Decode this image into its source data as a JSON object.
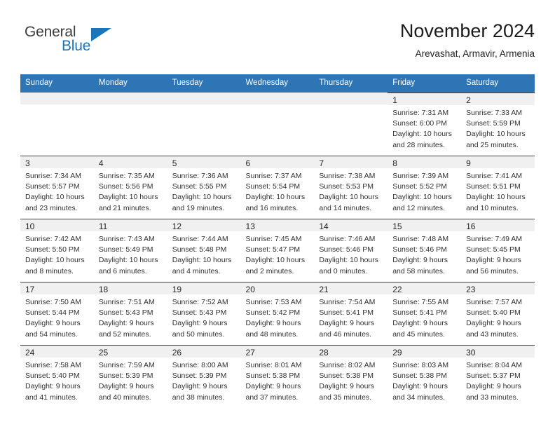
{
  "brand": {
    "name_part1": "General",
    "name_part2": "Blue",
    "triangle_color": "#1b75bb"
  },
  "header": {
    "title": "November 2024",
    "subtitle": "Arevashat, Armavir, Armenia",
    "header_bg_color": "#2e75b6",
    "daynum_bg_color": "#f0f0f0"
  },
  "weekday_headers": [
    "Sunday",
    "Monday",
    "Tuesday",
    "Wednesday",
    "Thursday",
    "Friday",
    "Saturday"
  ],
  "weeks": [
    [
      {
        "day": "",
        "sunrise": "",
        "sunset": "",
        "daylight1": "",
        "daylight2": ""
      },
      {
        "day": "",
        "sunrise": "",
        "sunset": "",
        "daylight1": "",
        "daylight2": ""
      },
      {
        "day": "",
        "sunrise": "",
        "sunset": "",
        "daylight1": "",
        "daylight2": ""
      },
      {
        "day": "",
        "sunrise": "",
        "sunset": "",
        "daylight1": "",
        "daylight2": ""
      },
      {
        "day": "",
        "sunrise": "",
        "sunset": "",
        "daylight1": "",
        "daylight2": ""
      },
      {
        "day": "1",
        "sunrise": "Sunrise: 7:31 AM",
        "sunset": "Sunset: 6:00 PM",
        "daylight1": "Daylight: 10 hours",
        "daylight2": "and 28 minutes."
      },
      {
        "day": "2",
        "sunrise": "Sunrise: 7:33 AM",
        "sunset": "Sunset: 5:59 PM",
        "daylight1": "Daylight: 10 hours",
        "daylight2": "and 25 minutes."
      }
    ],
    [
      {
        "day": "3",
        "sunrise": "Sunrise: 7:34 AM",
        "sunset": "Sunset: 5:57 PM",
        "daylight1": "Daylight: 10 hours",
        "daylight2": "and 23 minutes."
      },
      {
        "day": "4",
        "sunrise": "Sunrise: 7:35 AM",
        "sunset": "Sunset: 5:56 PM",
        "daylight1": "Daylight: 10 hours",
        "daylight2": "and 21 minutes."
      },
      {
        "day": "5",
        "sunrise": "Sunrise: 7:36 AM",
        "sunset": "Sunset: 5:55 PM",
        "daylight1": "Daylight: 10 hours",
        "daylight2": "and 19 minutes."
      },
      {
        "day": "6",
        "sunrise": "Sunrise: 7:37 AM",
        "sunset": "Sunset: 5:54 PM",
        "daylight1": "Daylight: 10 hours",
        "daylight2": "and 16 minutes."
      },
      {
        "day": "7",
        "sunrise": "Sunrise: 7:38 AM",
        "sunset": "Sunset: 5:53 PM",
        "daylight1": "Daylight: 10 hours",
        "daylight2": "and 14 minutes."
      },
      {
        "day": "8",
        "sunrise": "Sunrise: 7:39 AM",
        "sunset": "Sunset: 5:52 PM",
        "daylight1": "Daylight: 10 hours",
        "daylight2": "and 12 minutes."
      },
      {
        "day": "9",
        "sunrise": "Sunrise: 7:41 AM",
        "sunset": "Sunset: 5:51 PM",
        "daylight1": "Daylight: 10 hours",
        "daylight2": "and 10 minutes."
      }
    ],
    [
      {
        "day": "10",
        "sunrise": "Sunrise: 7:42 AM",
        "sunset": "Sunset: 5:50 PM",
        "daylight1": "Daylight: 10 hours",
        "daylight2": "and 8 minutes."
      },
      {
        "day": "11",
        "sunrise": "Sunrise: 7:43 AM",
        "sunset": "Sunset: 5:49 PM",
        "daylight1": "Daylight: 10 hours",
        "daylight2": "and 6 minutes."
      },
      {
        "day": "12",
        "sunrise": "Sunrise: 7:44 AM",
        "sunset": "Sunset: 5:48 PM",
        "daylight1": "Daylight: 10 hours",
        "daylight2": "and 4 minutes."
      },
      {
        "day": "13",
        "sunrise": "Sunrise: 7:45 AM",
        "sunset": "Sunset: 5:47 PM",
        "daylight1": "Daylight: 10 hours",
        "daylight2": "and 2 minutes."
      },
      {
        "day": "14",
        "sunrise": "Sunrise: 7:46 AM",
        "sunset": "Sunset: 5:46 PM",
        "daylight1": "Daylight: 10 hours",
        "daylight2": "and 0 minutes."
      },
      {
        "day": "15",
        "sunrise": "Sunrise: 7:48 AM",
        "sunset": "Sunset: 5:46 PM",
        "daylight1": "Daylight: 9 hours",
        "daylight2": "and 58 minutes."
      },
      {
        "day": "16",
        "sunrise": "Sunrise: 7:49 AM",
        "sunset": "Sunset: 5:45 PM",
        "daylight1": "Daylight: 9 hours",
        "daylight2": "and 56 minutes."
      }
    ],
    [
      {
        "day": "17",
        "sunrise": "Sunrise: 7:50 AM",
        "sunset": "Sunset: 5:44 PM",
        "daylight1": "Daylight: 9 hours",
        "daylight2": "and 54 minutes."
      },
      {
        "day": "18",
        "sunrise": "Sunrise: 7:51 AM",
        "sunset": "Sunset: 5:43 PM",
        "daylight1": "Daylight: 9 hours",
        "daylight2": "and 52 minutes."
      },
      {
        "day": "19",
        "sunrise": "Sunrise: 7:52 AM",
        "sunset": "Sunset: 5:43 PM",
        "daylight1": "Daylight: 9 hours",
        "daylight2": "and 50 minutes."
      },
      {
        "day": "20",
        "sunrise": "Sunrise: 7:53 AM",
        "sunset": "Sunset: 5:42 PM",
        "daylight1": "Daylight: 9 hours",
        "daylight2": "and 48 minutes."
      },
      {
        "day": "21",
        "sunrise": "Sunrise: 7:54 AM",
        "sunset": "Sunset: 5:41 PM",
        "daylight1": "Daylight: 9 hours",
        "daylight2": "and 46 minutes."
      },
      {
        "day": "22",
        "sunrise": "Sunrise: 7:55 AM",
        "sunset": "Sunset: 5:41 PM",
        "daylight1": "Daylight: 9 hours",
        "daylight2": "and 45 minutes."
      },
      {
        "day": "23",
        "sunrise": "Sunrise: 7:57 AM",
        "sunset": "Sunset: 5:40 PM",
        "daylight1": "Daylight: 9 hours",
        "daylight2": "and 43 minutes."
      }
    ],
    [
      {
        "day": "24",
        "sunrise": "Sunrise: 7:58 AM",
        "sunset": "Sunset: 5:40 PM",
        "daylight1": "Daylight: 9 hours",
        "daylight2": "and 41 minutes."
      },
      {
        "day": "25",
        "sunrise": "Sunrise: 7:59 AM",
        "sunset": "Sunset: 5:39 PM",
        "daylight1": "Daylight: 9 hours",
        "daylight2": "and 40 minutes."
      },
      {
        "day": "26",
        "sunrise": "Sunrise: 8:00 AM",
        "sunset": "Sunset: 5:39 PM",
        "daylight1": "Daylight: 9 hours",
        "daylight2": "and 38 minutes."
      },
      {
        "day": "27",
        "sunrise": "Sunrise: 8:01 AM",
        "sunset": "Sunset: 5:38 PM",
        "daylight1": "Daylight: 9 hours",
        "daylight2": "and 37 minutes."
      },
      {
        "day": "28",
        "sunrise": "Sunrise: 8:02 AM",
        "sunset": "Sunset: 5:38 PM",
        "daylight1": "Daylight: 9 hours",
        "daylight2": "and 35 minutes."
      },
      {
        "day": "29",
        "sunrise": "Sunrise: 8:03 AM",
        "sunset": "Sunset: 5:38 PM",
        "daylight1": "Daylight: 9 hours",
        "daylight2": "and 34 minutes."
      },
      {
        "day": "30",
        "sunrise": "Sunrise: 8:04 AM",
        "sunset": "Sunset: 5:37 PM",
        "daylight1": "Daylight: 9 hours",
        "daylight2": "and 33 minutes."
      }
    ]
  ]
}
